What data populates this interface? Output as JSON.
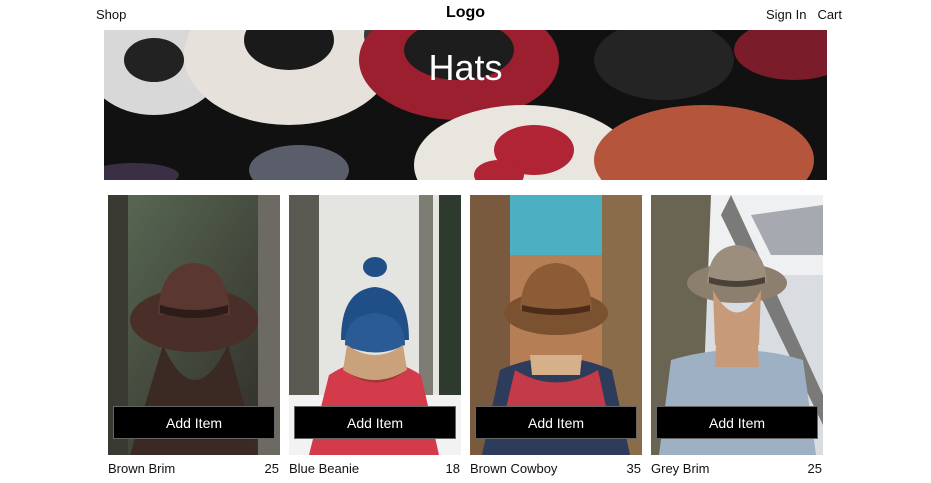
{
  "nav": {
    "shop_label": "Shop",
    "logo_label": "Logo",
    "signin_label": "Sign In",
    "cart_label": "Cart"
  },
  "hero": {
    "title": "Hats"
  },
  "products": [
    {
      "name": "Brown Brim",
      "price": "25",
      "button_label": "Add Item"
    },
    {
      "name": "Blue Beanie",
      "price": "18",
      "button_label": "Add Item"
    },
    {
      "name": "Brown Cowboy",
      "price": "35",
      "button_label": "Add Item"
    },
    {
      "name": "Grey Brim",
      "price": "25",
      "button_label": "Add Item"
    }
  ]
}
